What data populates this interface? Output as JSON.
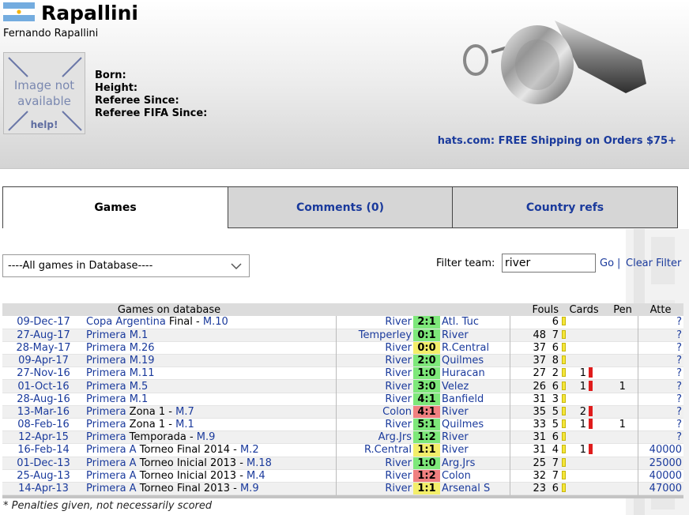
{
  "referee": {
    "short_name": "Rapallini",
    "full_name": "Fernando Rapallini",
    "flag": "argentina-flag"
  },
  "no_image": {
    "line1": "Image not",
    "line2": "available",
    "help": "help!"
  },
  "info": {
    "born": "Born:",
    "height": "Height:",
    "referee_since": "Referee Since:",
    "referee_fifa_since": "Referee FIFA Since:"
  },
  "promo": "hats.com: FREE Shipping on Orders $75+",
  "tabs": [
    {
      "label": "Games",
      "active": true
    },
    {
      "label": "Comments (0)",
      "active": false
    },
    {
      "label": "Country refs",
      "active": false
    }
  ],
  "filter": {
    "select_value": "----All games in Database----",
    "label": "Filter team:",
    "value": "river",
    "go": "Go",
    "separator": "|",
    "clear": "Clear Filter"
  },
  "table": {
    "headers": {
      "games": "Games on database",
      "fouls": "Fouls",
      "cards": "Cards",
      "pen": "Pen",
      "att": "Atte"
    },
    "rows": [
      {
        "date": "09-Dec-17",
        "comp": "Copa Argentina",
        "comp_black": " Final - ",
        "round": "M.10",
        "home": "River",
        "score": "2:1",
        "result": "win",
        "away": "Atl. Tuc",
        "fouls": "",
        "yellow": "6",
        "red": "",
        "pen": "",
        "att": "?"
      },
      {
        "date": "27-Aug-17",
        "comp": "Primera",
        "comp_black": " ",
        "round": "M.1",
        "home": "Temperley",
        "score": "0:1",
        "result": "win",
        "away": "River",
        "fouls": "48",
        "yellow": "7",
        "red": "",
        "pen": "",
        "att": "?"
      },
      {
        "date": "28-May-17",
        "comp": "Primera",
        "comp_black": " ",
        "round": "M.26",
        "home": "River",
        "score": "0:0",
        "result": "draw",
        "away": "R.Central",
        "fouls": "37",
        "yellow": "6",
        "red": "",
        "pen": "",
        "att": "?"
      },
      {
        "date": "09-Apr-17",
        "comp": "Primera",
        "comp_black": " ",
        "round": "M.19",
        "home": "River",
        "score": "2:0",
        "result": "win",
        "away": "Quilmes",
        "fouls": "37",
        "yellow": "8",
        "red": "",
        "pen": "",
        "att": "?"
      },
      {
        "date": "27-Nov-16",
        "comp": "Primera",
        "comp_black": " ",
        "round": "M.11",
        "home": "River",
        "score": "1:0",
        "result": "win",
        "away": "Huracan",
        "fouls": "27",
        "yellow": "2",
        "red": "1",
        "pen": "",
        "att": "?"
      },
      {
        "date": "01-Oct-16",
        "comp": "Primera",
        "comp_black": " ",
        "round": "M.5",
        "home": "River",
        "score": "3:0",
        "result": "win",
        "away": "Velez",
        "fouls": "26",
        "yellow": "6",
        "red": "1",
        "pen": "1",
        "att": "?"
      },
      {
        "date": "28-Aug-16",
        "comp": "Primera",
        "comp_black": " ",
        "round": "M.1",
        "home": "River",
        "score": "4:1",
        "result": "win",
        "away": "Banfield",
        "fouls": "31",
        "yellow": "3",
        "red": "",
        "pen": "",
        "att": "?"
      },
      {
        "date": "13-Mar-16",
        "comp": "Primera",
        "comp_black": " Zona 1 - ",
        "round": "M.7",
        "home": "Colon",
        "score": "4:1",
        "result": "loss",
        "away": "River",
        "fouls": "35",
        "yellow": "5",
        "red": "2",
        "pen": "",
        "att": "?"
      },
      {
        "date": "08-Feb-16",
        "comp": "Primera",
        "comp_black": " Zona 1 - ",
        "round": "M.1",
        "home": "River",
        "score": "5:1",
        "result": "win",
        "away": "Quilmes",
        "fouls": "33",
        "yellow": "5",
        "red": "1",
        "pen": "1",
        "att": "?"
      },
      {
        "date": "12-Apr-15",
        "comp": "Primera",
        "comp_black": " Temporada - ",
        "round": "M.9",
        "home": "Arg.Jrs",
        "score": "1:2",
        "result": "win",
        "away": "River",
        "fouls": "31",
        "yellow": "6",
        "red": "",
        "pen": "",
        "att": "?"
      },
      {
        "date": "16-Feb-14",
        "comp": "Primera A",
        "comp_black": " Torneo Final 2014 - ",
        "round": "M.2",
        "home": "R.Central",
        "score": "1:1",
        "result": "draw",
        "away": "River",
        "fouls": "31",
        "yellow": "4",
        "red": "1",
        "pen": "",
        "att": "40000"
      },
      {
        "date": "01-Dec-13",
        "comp": "Primera A",
        "comp_black": " Torneo Inicial 2013 - ",
        "round": "M.18",
        "home": "River",
        "score": "1:0",
        "result": "win",
        "away": "Arg.Jrs",
        "fouls": "25",
        "yellow": "7",
        "red": "",
        "pen": "",
        "att": "25000"
      },
      {
        "date": "25-Aug-13",
        "comp": "Primera A",
        "comp_black": " Torneo Inicial 2013 - ",
        "round": "M.4",
        "home": "River",
        "score": "1:2",
        "result": "loss",
        "away": "Colon",
        "fouls": "32",
        "yellow": "7",
        "red": "",
        "pen": "",
        "att": "40000"
      },
      {
        "date": "14-Apr-13",
        "comp": "Primera A",
        "comp_black": " Torneo Final 2013 - ",
        "round": "M.9",
        "home": "River",
        "score": "1:1",
        "result": "draw",
        "away": "Arsenal S",
        "fouls": "23",
        "yellow": "6",
        "red": "",
        "pen": "",
        "att": "47000"
      }
    ]
  },
  "result_colors": {
    "win": "#7ee87a",
    "draw": "#f3ee6a",
    "loss": "#f08080"
  },
  "footnote": "* Penalties given, not necessarily scored"
}
